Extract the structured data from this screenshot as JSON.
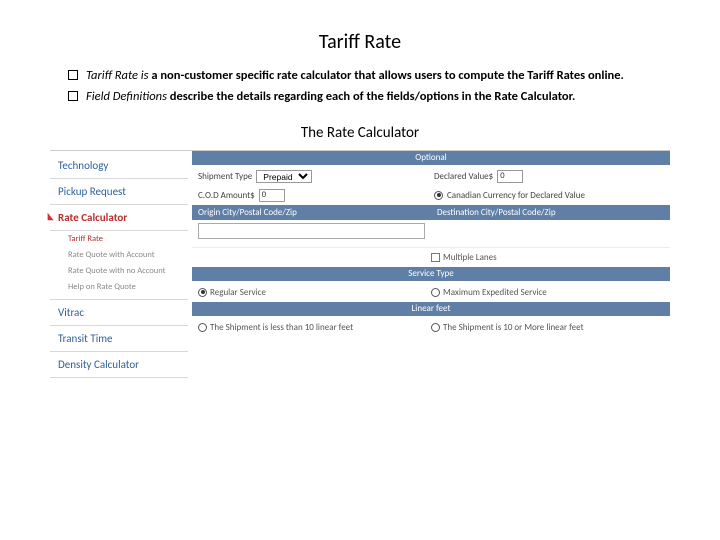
{
  "title": "Tariff Rate",
  "bullets": [
    {
      "em": "Tariff Rate is",
      "rest": " a non-customer specific rate calculator that allows users to compute the Tariff Rates online."
    },
    {
      "em": "Field Definitions",
      "rest": " describe the details regarding each of the fields/options in the Rate Calculator."
    }
  ],
  "subtitle": "The Rate Calculator",
  "sidebar": {
    "items": [
      "Technology",
      "Pickup Request",
      "Rate Calculator",
      "Vitrac",
      "Transit Time",
      "Density Calculator"
    ],
    "active_index": 2,
    "sub": [
      "Tariff Rate",
      "Rate Quote with Account",
      "Rate Quote with no Account",
      "Help on Rate Quote"
    ],
    "sub_current": 0
  },
  "form": {
    "optional_header": "Optional",
    "shipment_type_label": "Shipment Type",
    "shipment_type_value": "Prepaid",
    "declared_label": "Declared Value$",
    "declared_value": "0",
    "cod_label": "C.O.D Amount$",
    "cod_value": "0",
    "currency_label": "Canadian Currency for Declared Value",
    "origin_header": "Origin City/Postal Code/Zip",
    "dest_header": "Destination City/Postal Code/Zip",
    "multiple_lanes": "Multiple Lanes",
    "service_header": "Service Type",
    "service_regular": "Regular Service",
    "service_max": "Maximum Expedited Service",
    "linear_header": "Linear feet",
    "linear_less": "The Shipment is less than 10 linear feet",
    "linear_more": "The Shipment is 10 or More linear feet"
  }
}
